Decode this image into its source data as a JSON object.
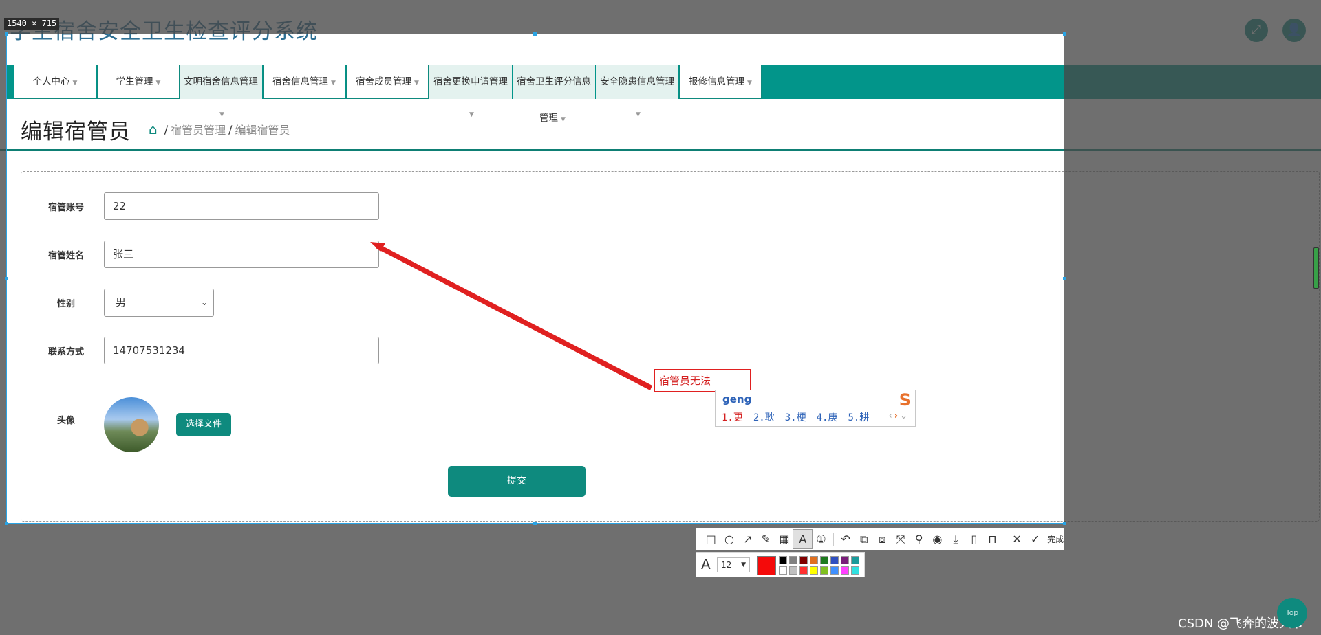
{
  "app": {
    "title": "学生宿舍安全卫生检查评分系统",
    "fullscreen_icon": "expand-icon",
    "user_icon": "user-icon"
  },
  "screenshot_tool": {
    "size_label": "1540 × 715",
    "annotation_text": "宿管员无法",
    "ime": {
      "input": "geng",
      "candidates": [
        "1.更",
        "2.耿",
        "3.梗",
        "4.庚",
        "5.耕"
      ],
      "logo": "S"
    },
    "toolbar": {
      "icons": [
        "rect-icon",
        "ellipse-icon",
        "arrow-icon",
        "pen-icon",
        "mosaic-icon",
        "text-icon",
        "serial-number-icon",
        "undo-icon",
        "ocr-icon",
        "translate-icon",
        "scroll-capture-icon",
        "pin-icon",
        "record-icon",
        "save-icon",
        "device-icon",
        "bookmark-icon",
        "close-icon",
        "done-icon"
      ],
      "done_label": "完成"
    },
    "text_settings": {
      "font_size": "12",
      "current_color": "#ff0000",
      "palette": [
        "#000000",
        "#808080",
        "#800000",
        "#e07020",
        "#1e7a1e",
        "#3050c0",
        "#7a1e7a",
        "#1a9a9a",
        "#ffffff",
        "#c0c0c0",
        "#ff3030",
        "#ffff00",
        "#80c020",
        "#4090ff",
        "#ff40ff",
        "#30e0e0"
      ]
    }
  },
  "nav": {
    "items": [
      {
        "label": "个人中心"
      },
      {
        "label": "学生管理"
      },
      {
        "label": "文明宿舍信息管理"
      },
      {
        "label": "宿舍信息管理"
      },
      {
        "label": "宿舍成员管理"
      },
      {
        "label": "宿舍更换申请管理"
      },
      {
        "label": "宿舍卫生评分信息"
      },
      {
        "label": "安全隐患信息管理"
      },
      {
        "label": "报修信息管理"
      }
    ],
    "overflow_text": "管理"
  },
  "page": {
    "title": "编辑宿管员",
    "breadcrumb": [
      "宿管员管理",
      "编辑宿管员"
    ]
  },
  "form": {
    "account": {
      "label": "宿管账号",
      "value": "22"
    },
    "name": {
      "label": "宿管姓名",
      "value": "张三"
    },
    "gender": {
      "label": "性别",
      "value": "男"
    },
    "phone": {
      "label": "联系方式",
      "value": "14707531234"
    },
    "avatar": {
      "label": "头像",
      "button": "选择文件"
    },
    "submit": "提交"
  },
  "footer": {
    "watermark": "CSDN @飞奔的波大爷",
    "top_button": "Top"
  }
}
